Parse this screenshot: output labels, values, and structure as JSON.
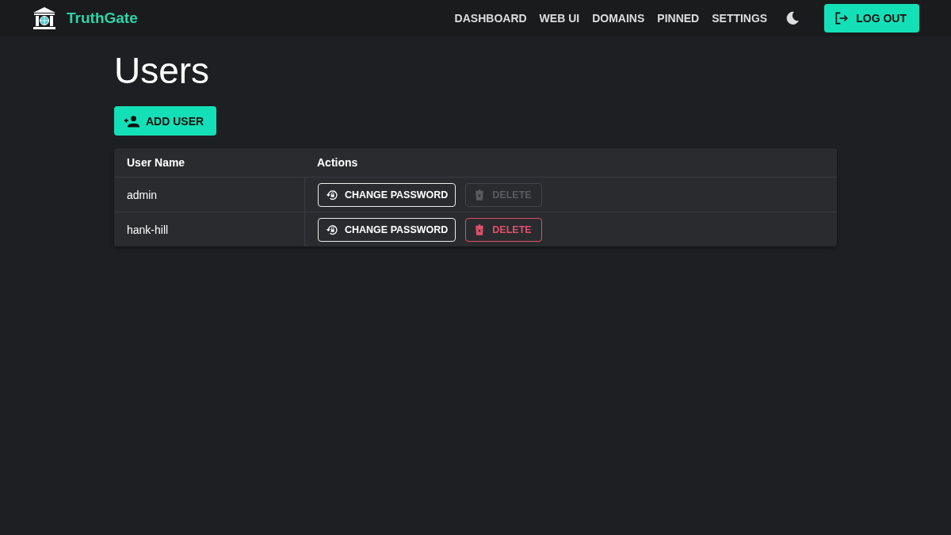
{
  "app": {
    "brand": "TruthGate"
  },
  "nav": [
    "DASHBOARD",
    "WEB UI",
    "DOMAINS",
    "PINNED",
    "SETTINGS"
  ],
  "logout": "LOG OUT",
  "page_title": "Users",
  "add_button": "ADD USER",
  "table": {
    "columns": [
      "User Name",
      "Actions"
    ],
    "rows": [
      {
        "name": "admin",
        "change_label": "CHANGE PASSWORD",
        "delete_label": "DELETE",
        "delete_disabled": true
      },
      {
        "name": "hank-hill",
        "change_label": "CHANGE PASSWORD",
        "delete_label": "DELETE",
        "delete_disabled": false
      }
    ]
  }
}
